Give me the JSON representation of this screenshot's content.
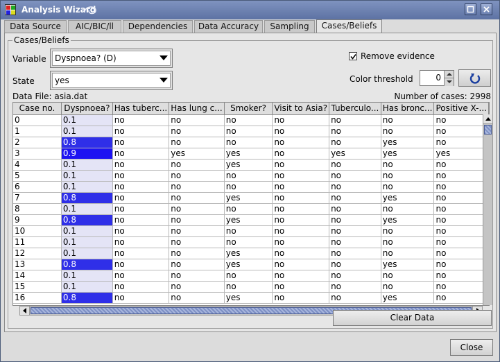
{
  "window": {
    "title": "Analysis Wizard"
  },
  "tabs": [
    {
      "label": "Data Source"
    },
    {
      "label": "AIC/BIC/ll"
    },
    {
      "label": "Dependencies"
    },
    {
      "label": "Data Accuracy"
    },
    {
      "label": "Sampling"
    },
    {
      "label": "Cases/Beliefs"
    }
  ],
  "active_tab": "Cases/Beliefs",
  "group": {
    "title": "Cases/Beliefs",
    "variable_label": "Variable",
    "variable_value": "Dyspnoea? (D)",
    "state_label": "State",
    "state_value": "yes",
    "remove_evidence_label": "Remove evidence",
    "remove_evidence_checked": true,
    "color_threshold_label": "Color threshold",
    "color_threshold_value": "0",
    "data_file_text": "Data File:  asia.dat",
    "num_cases_text": "Number of cases: 2998"
  },
  "table": {
    "headers": [
      "Case no.",
      "Dyspnoea?",
      "Has tuberc...",
      "Has lung c...",
      "Smoker?",
      "Visit to Asia?",
      "Tuberculo...",
      "Has bronc...",
      "Positive X-..."
    ],
    "rows": [
      [
        "0",
        "0.1",
        "no",
        "no",
        "no",
        "no",
        "no",
        "no",
        "no"
      ],
      [
        "1",
        "0.1",
        "no",
        "no",
        "no",
        "no",
        "no",
        "no",
        "no"
      ],
      [
        "2",
        "0.8",
        "no",
        "no",
        "no",
        "no",
        "no",
        "yes",
        "no"
      ],
      [
        "3",
        "0.9",
        "no",
        "yes",
        "yes",
        "no",
        "yes",
        "yes",
        "yes"
      ],
      [
        "4",
        "0.1",
        "no",
        "no",
        "yes",
        "no",
        "no",
        "no",
        "no"
      ],
      [
        "5",
        "0.1",
        "no",
        "no",
        "no",
        "no",
        "no",
        "no",
        "no"
      ],
      [
        "6",
        "0.1",
        "no",
        "no",
        "no",
        "no",
        "no",
        "no",
        "no"
      ],
      [
        "7",
        "0.8",
        "no",
        "no",
        "yes",
        "no",
        "no",
        "yes",
        "no"
      ],
      [
        "8",
        "0.1",
        "no",
        "no",
        "no",
        "no",
        "no",
        "no",
        "no"
      ],
      [
        "9",
        "0.8",
        "no",
        "no",
        "yes",
        "no",
        "no",
        "yes",
        "no"
      ],
      [
        "10",
        "0.1",
        "no",
        "no",
        "no",
        "no",
        "no",
        "no",
        "no"
      ],
      [
        "11",
        "0.1",
        "no",
        "no",
        "no",
        "no",
        "no",
        "no",
        "no"
      ],
      [
        "12",
        "0.1",
        "no",
        "no",
        "yes",
        "no",
        "no",
        "no",
        "no"
      ],
      [
        "13",
        "0.8",
        "no",
        "no",
        "yes",
        "no",
        "no",
        "yes",
        "no"
      ],
      [
        "14",
        "0.1",
        "no",
        "no",
        "no",
        "no",
        "no",
        "no",
        "no"
      ],
      [
        "15",
        "0.1",
        "no",
        "no",
        "no",
        "no",
        "no",
        "no",
        "no"
      ],
      [
        "16",
        "0.8",
        "no",
        "no",
        "yes",
        "no",
        "no",
        "yes",
        "no"
      ]
    ]
  },
  "buttons": {
    "clear_data": "Clear Data",
    "close": "Close"
  },
  "colors": {
    "belief_high": "#1d12f2",
    "belief_mid": "#2f2fe8",
    "belief_low": "#e4e4f6",
    "title_bar": "#6a7fb0"
  },
  "icons": {
    "app": "app-icon",
    "refresh": "refresh-icon",
    "maximize": "maximize-icon",
    "close": "close-icon"
  }
}
